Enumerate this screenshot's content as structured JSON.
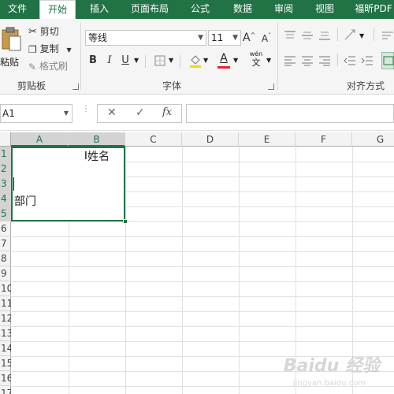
{
  "tabs": [
    {
      "label": "文件",
      "active": false
    },
    {
      "label": "开始",
      "active": true
    },
    {
      "label": "插入",
      "active": false
    },
    {
      "label": "页面布局",
      "active": false
    },
    {
      "label": "公式",
      "active": false
    },
    {
      "label": "数据",
      "active": false
    },
    {
      "label": "审阅",
      "active": false
    },
    {
      "label": "视图",
      "active": false
    },
    {
      "label": "福昕PDF",
      "active": false
    }
  ],
  "clipboard": {
    "paste_label": "粘贴",
    "cut_label": "剪切",
    "copy_label": "复制",
    "format_painter_label": "格式刷",
    "group_label": "剪贴板"
  },
  "font": {
    "font_name": "等线",
    "font_size": "11",
    "bold": "B",
    "italic": "I",
    "underline": "U",
    "font_color_letter": "A",
    "phonetic_top": "wén",
    "phonetic_bottom": "文",
    "grow_letter": "A",
    "shrink_letter": "A",
    "group_label": "字体"
  },
  "alignment": {
    "group_label": "对齐方式"
  },
  "formula_bar": {
    "name_box": "A1",
    "cancel_glyph": "✕",
    "enter_glyph": "✓",
    "fx_label": "fx",
    "content": ""
  },
  "columns": [
    "A",
    "B",
    "C",
    "D",
    "E",
    "F",
    "G"
  ],
  "rows": [
    "1",
    "2",
    "3",
    "4",
    "5",
    "6",
    "7",
    "8",
    "9",
    "10",
    "11",
    "12",
    "13",
    "14",
    "15",
    "16",
    "17"
  ],
  "cells": {
    "b1": "姓名",
    "a4": "部门"
  },
  "watermark": {
    "text": "Baidu 经验",
    "sub": "jingyan.baidu.com"
  },
  "colors": {
    "accent": "#217346",
    "font_color_bar": "#e0262b"
  }
}
